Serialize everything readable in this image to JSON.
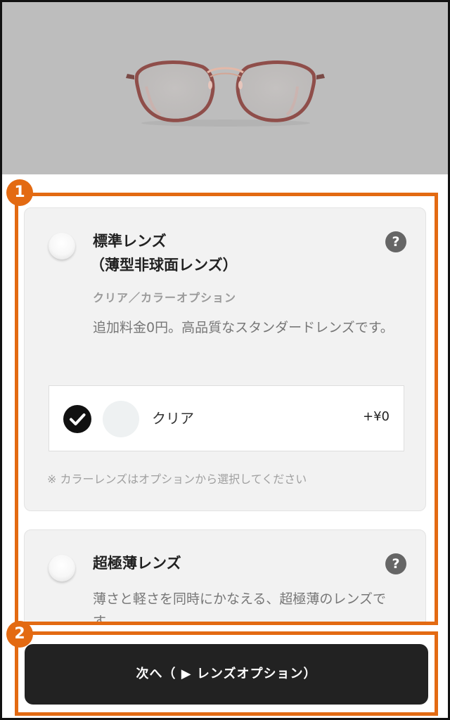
{
  "product": {
    "image_icon": "eyeglasses-product-image",
    "frame_color": "#9a5a55",
    "background_color": "#bdbdbd"
  },
  "lens_options": [
    {
      "title_line1": "標準レンズ",
      "title_line2": "（薄型非球面レンズ）",
      "subtitle": "クリア／カラーオプション",
      "description": "追加料金0円。高品質なスタンダードレンズです。",
      "selected": false,
      "help_icon": "?",
      "choice": {
        "name": "クリア",
        "price": "+¥0",
        "checked": true
      },
      "note": "※ カラーレンズはオプションから選択してください"
    },
    {
      "title_line1": "超極薄レンズ",
      "description": "薄さと軽さを同時にかなえる、超極薄のレンズです。",
      "selected": false,
      "help_icon": "?"
    }
  ],
  "next_button": {
    "label": "次へ（ ▶ レンズオプション）"
  },
  "annotations": {
    "badge_1": "1",
    "badge_2": "2",
    "color": "#e36a12"
  }
}
